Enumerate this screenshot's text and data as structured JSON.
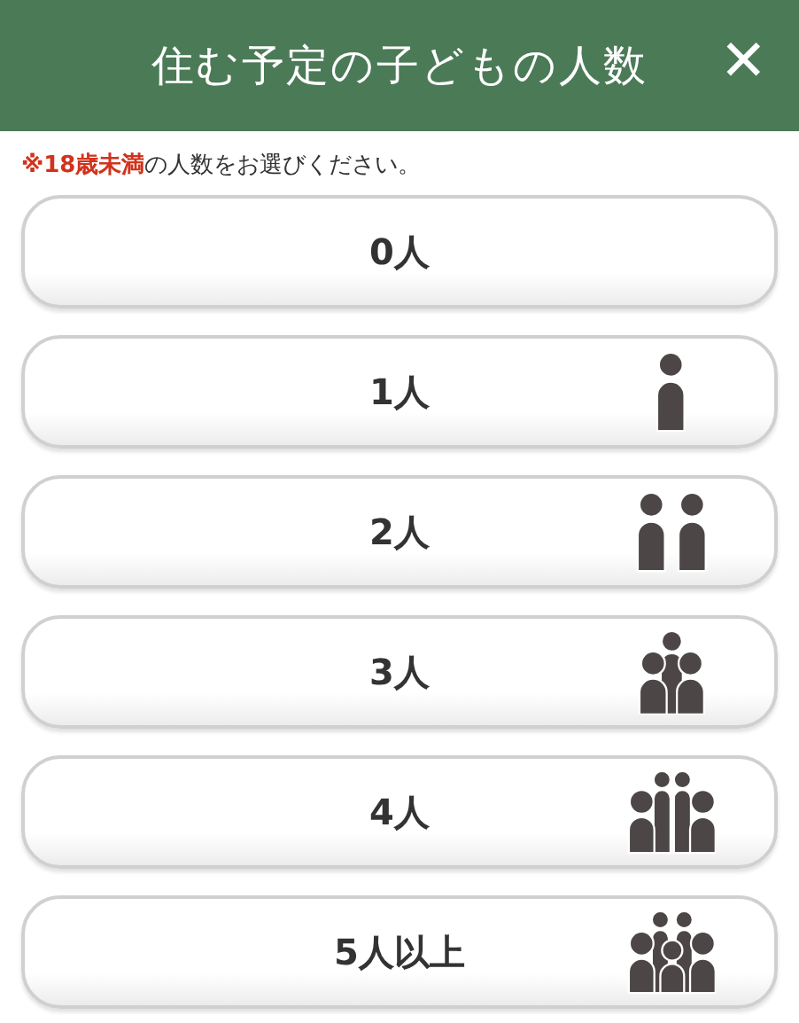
{
  "header": {
    "title": "住む予定の子どもの人数",
    "close": "✕"
  },
  "note": {
    "emphasis": "※18歳未満",
    "text": "の人数をお選びください。"
  },
  "options": [
    {
      "label": "0人",
      "kind": "none"
    },
    {
      "label": "1人",
      "kind": "one"
    },
    {
      "label": "2人",
      "kind": "two"
    },
    {
      "label": "3人",
      "kind": "three"
    },
    {
      "label": "4人",
      "kind": "four"
    },
    {
      "label": "5人以上",
      "kind": "five"
    }
  ]
}
